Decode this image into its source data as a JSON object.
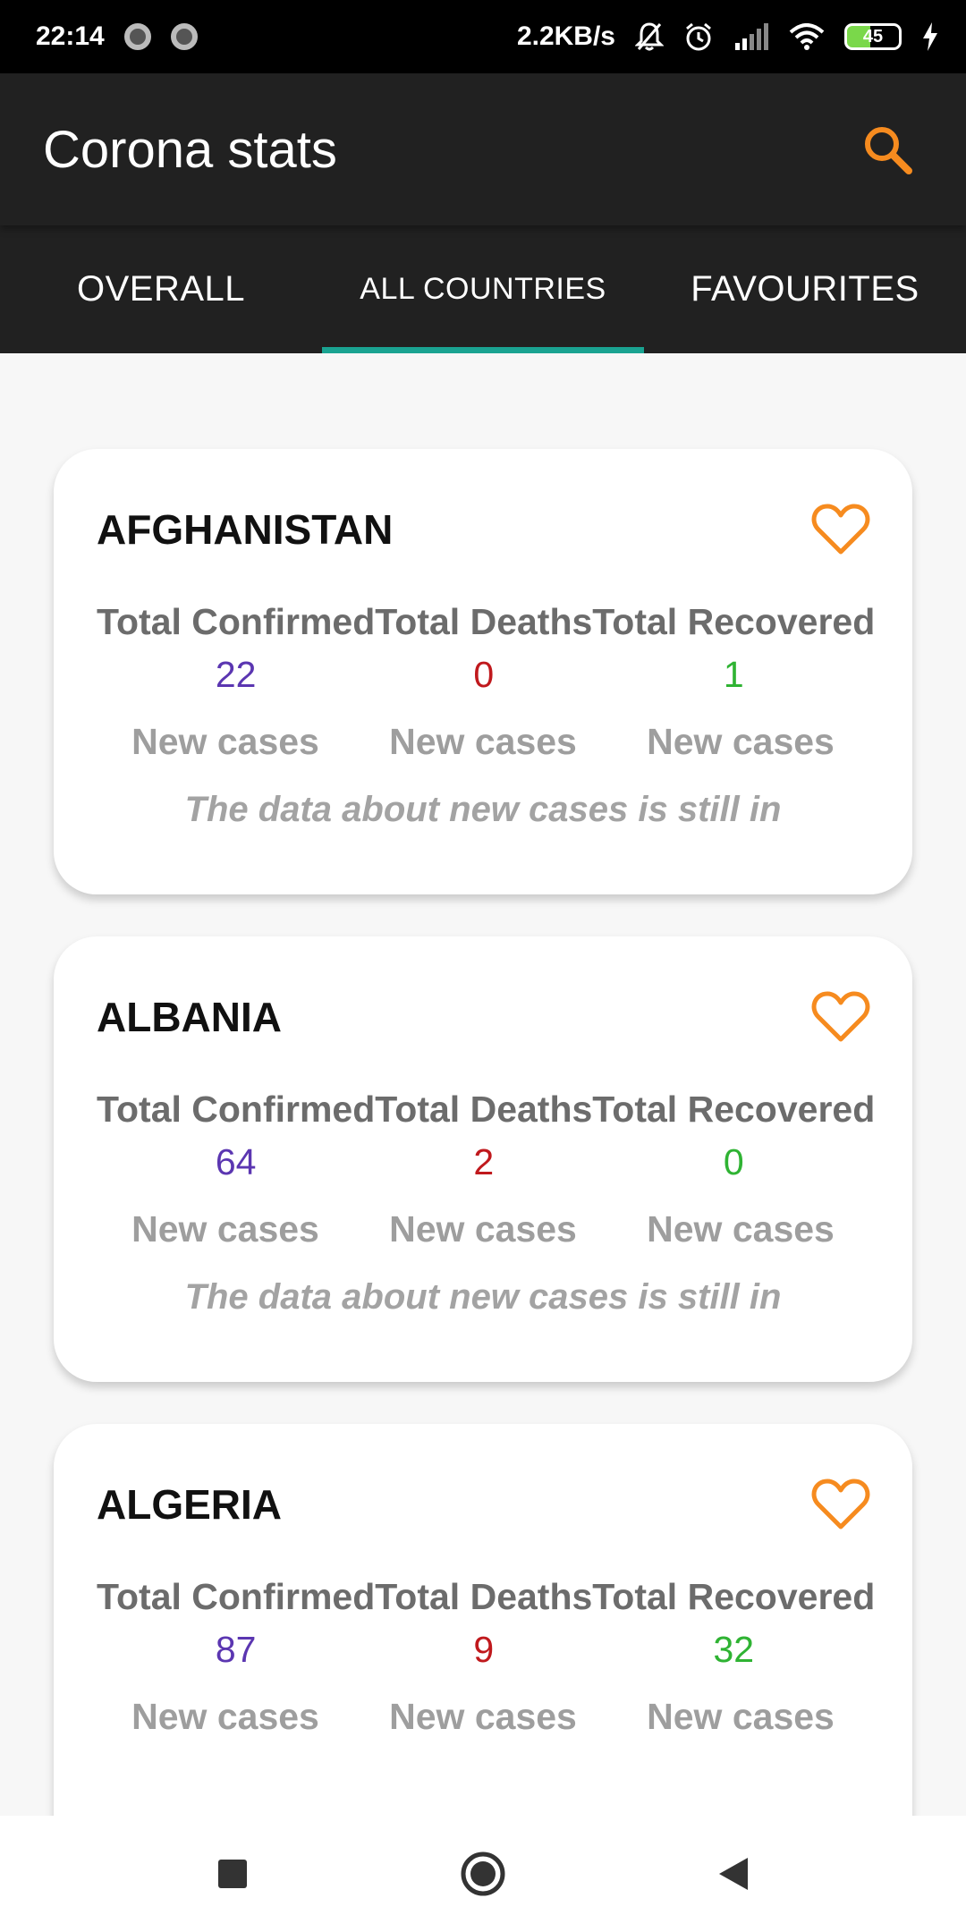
{
  "status_bar": {
    "time": "22:14",
    "speed": "2.2KB/s",
    "battery": "45",
    "icons": [
      "mute-bell-icon",
      "alarm-icon",
      "signal-icon",
      "wifi-icon",
      "battery-icon",
      "charging-icon"
    ]
  },
  "app_bar": {
    "title": "Corona stats",
    "search_icon": "search-icon",
    "accent_color": "#f68b1f"
  },
  "tabs": [
    {
      "label": "OVERALL",
      "active": false
    },
    {
      "label": "ALL COUNTRIES",
      "active": true
    },
    {
      "label": "FAVOURITES",
      "active": false
    }
  ],
  "labels": {
    "total_confirmed": "Total Confirmed",
    "total_deaths": "Total Deaths",
    "total_recovered": "Total Recovered",
    "new_cases": "New cases",
    "note": "The data about new cases is still in"
  },
  "countries": [
    {
      "name": "AFGHANISTAN",
      "confirmed": "22",
      "deaths": "0",
      "recovered": "1"
    },
    {
      "name": "ALBANIA",
      "confirmed": "64",
      "deaths": "2",
      "recovered": "0"
    },
    {
      "name": "ALGERIA",
      "confirmed": "87",
      "deaths": "9",
      "recovered": "32"
    }
  ],
  "colors": {
    "confirmed": "#5b36b1",
    "deaths": "#c0191d",
    "recovered": "#2fb333",
    "tab_indicator": "#1aa391",
    "heart": "#f68b1f"
  },
  "nav_bar": [
    "recents-square-icon",
    "home-circle-icon",
    "back-triangle-icon"
  ]
}
